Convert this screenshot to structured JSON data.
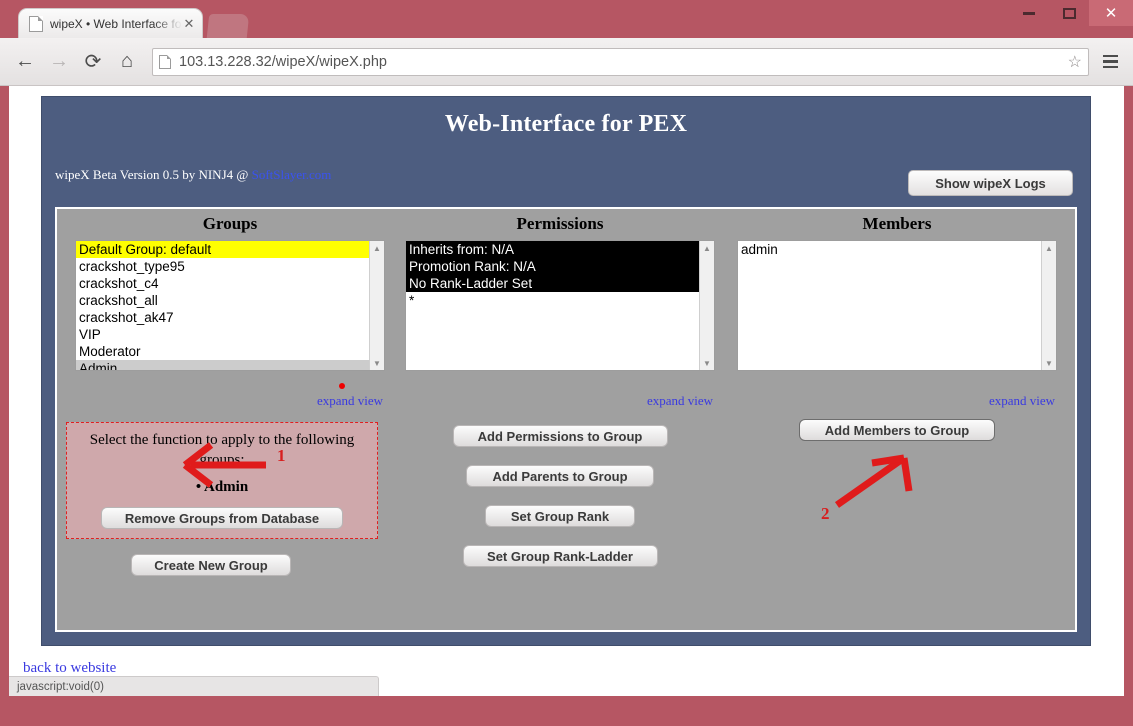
{
  "browser": {
    "tab_title": "wipeX • Web Interface for",
    "tab_close": "✕",
    "back_icon": "←",
    "forward_icon": "→",
    "reload_icon": "⟳",
    "home_icon": "⌂",
    "url": "103.13.228.32/wipeX/wipeX.php",
    "star_icon": "☆",
    "minimize_label": "",
    "maximize_label": "",
    "close_label": "✕",
    "status_text": "javascript:void(0)"
  },
  "page": {
    "title": "Web-Interface for PEX",
    "byline_prefix": "wipeX Beta Version 0.5 by NINJ4 @ ",
    "byline_link": "SoftSlayer.com",
    "show_logs_button": "Show wipeX Logs",
    "back_to_website": "back to website",
    "expand_view_label": "expand view"
  },
  "groups": {
    "heading": "Groups",
    "items": [
      {
        "label": "Default Group: default",
        "state": "yellow"
      },
      {
        "label": "crackshot_type95",
        "state": "normal"
      },
      {
        "label": "crackshot_c4",
        "state": "normal"
      },
      {
        "label": "crackshot_all",
        "state": "normal"
      },
      {
        "label": "crackshot_ak47",
        "state": "normal"
      },
      {
        "label": "VIP",
        "state": "normal"
      },
      {
        "label": "Moderator",
        "state": "normal"
      },
      {
        "label": "Admin",
        "state": "selected"
      }
    ],
    "function_prompt": "Select the function to apply to the following groups:",
    "selected_group": "• Admin",
    "remove_button": "Remove Groups from Database",
    "create_button": "Create New Group"
  },
  "permissions": {
    "heading": "Permissions",
    "items": [
      {
        "label": "Inherits from: N/A",
        "state": "inverse"
      },
      {
        "label": "Promotion Rank: N/A",
        "state": "inverse"
      },
      {
        "label": "No Rank-Ladder Set",
        "state": "inverse"
      },
      {
        "label": "*",
        "state": "normal"
      }
    ],
    "buttons": [
      "Add Permissions to Group",
      "Add Parents to Group",
      "Set Group Rank",
      "Set Group Rank-Ladder"
    ]
  },
  "members": {
    "heading": "Members",
    "items": [
      {
        "label": "admin",
        "state": "normal"
      }
    ],
    "add_button": "Add Members to Group"
  },
  "annotations": [
    {
      "number": "1",
      "target": "admin-group-row"
    },
    {
      "number": "2",
      "target": "add-members-to-group-button"
    }
  ],
  "colors": {
    "header_blue": "#4d5d80",
    "panel_gray": "#a0a0a0",
    "highlight_yellow": "#ffff00",
    "annotation_red": "#d81f1f",
    "link_blue": "#3a3ae0",
    "chrome_red": "#b65663"
  }
}
